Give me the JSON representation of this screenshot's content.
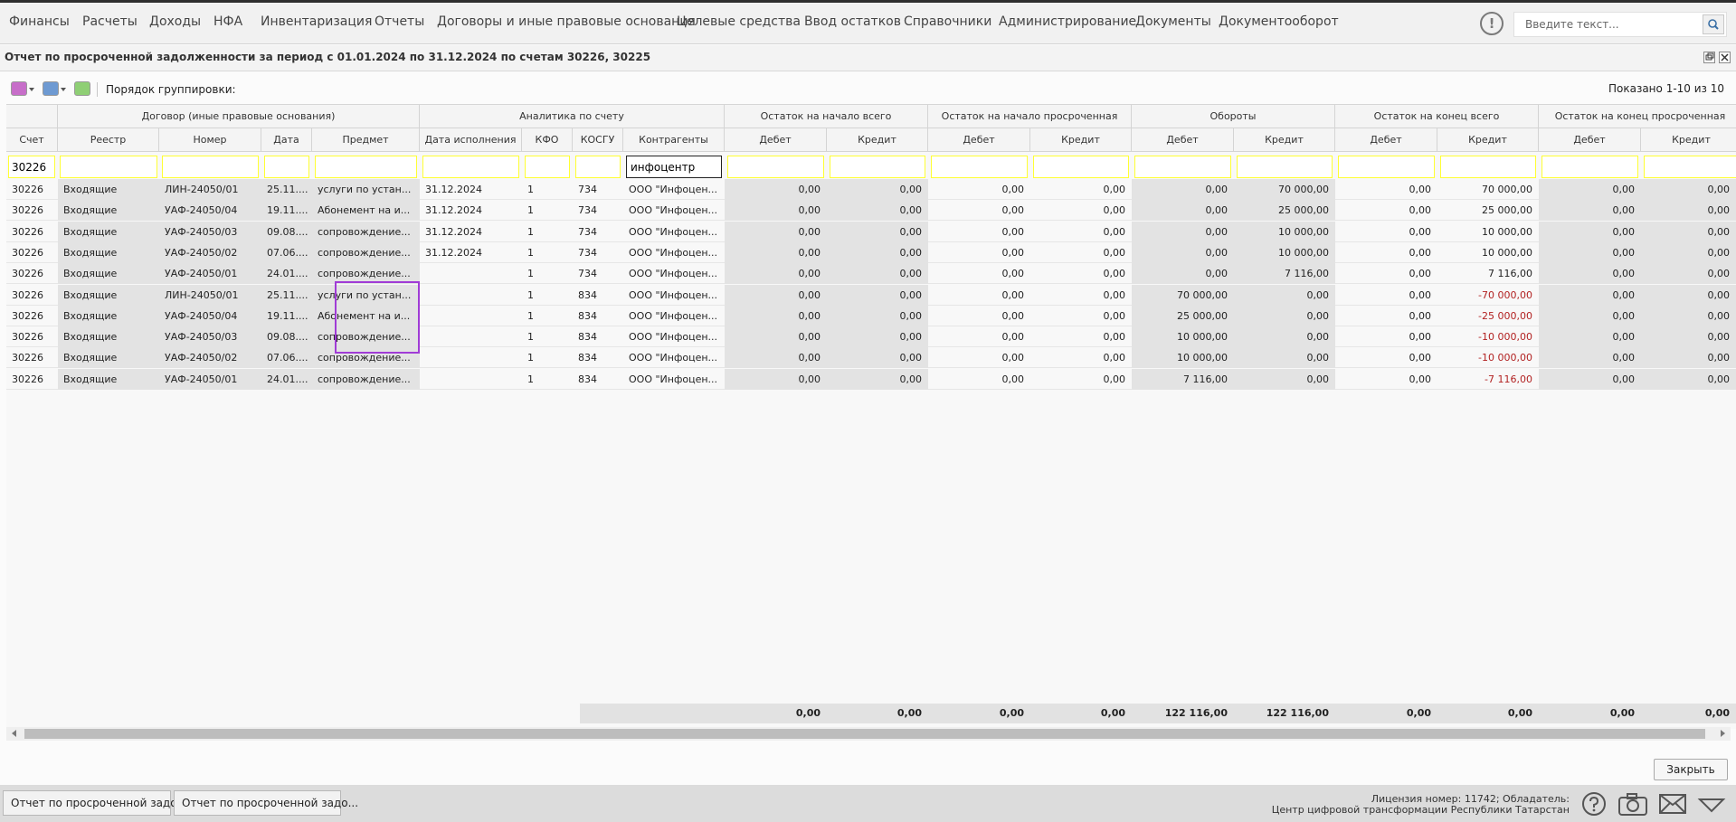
{
  "menu": [
    "Финансы",
    "Расчеты",
    "Доходы",
    "НФА",
    "Инвентаризация",
    "Отчеты",
    "Договоры и иные правовые основания",
    "Целевые средства",
    "Ввод остатков",
    "Справочники",
    "Администрирование",
    "Документы",
    "Документооборот"
  ],
  "alert_icon": "!",
  "search": {
    "placeholder": "Введите текст..."
  },
  "window": {
    "title": "Отчет по просроченной задолженности за период с 01.01.2024 по 31.12.2024 по счетам 30226, 30225"
  },
  "toolbar": {
    "group_label": "Порядок группировки:",
    "shown": "Показано 1-10 из 10"
  },
  "header_groups": [
    "Договор (иные правовые основания)",
    "Аналитика по счету",
    "Остаток на начало всего",
    "Остаток на начало просроченная",
    "Обороты",
    "Остаток на конец всего",
    "Остаток на конец просроченная"
  ],
  "columns": [
    "Счет",
    "Реестр",
    "Номер",
    "Дата",
    "Предмет",
    "Дата исполнения",
    "КФО",
    "КОСГУ",
    "Контрагенты",
    "Дебет",
    "Кредит",
    "Дебет",
    "Кредит",
    "Дебет",
    "Кредит",
    "Дебет",
    "Кредит",
    "Дебет",
    "Кредит"
  ],
  "filters": {
    "schet": "30226",
    "kontragenty": "инфоцентр"
  },
  "rows": [
    [
      "30226",
      "Входящие",
      "ЛИН-24050/01",
      "25.11....",
      "услуги по устан...",
      "31.12.2024",
      "1",
      "734",
      "ООО \"Инфоцен...",
      "0,00",
      "0,00",
      "0,00",
      "0,00",
      "0,00",
      "70 000,00",
      "0,00",
      "70 000,00",
      "0,00",
      "0,00"
    ],
    [
      "30226",
      "Входящие",
      "УАФ-24050/04",
      "19.11....",
      "Абонемент на и...",
      "31.12.2024",
      "1",
      "734",
      "ООО \"Инфоцен...",
      "0,00",
      "0,00",
      "0,00",
      "0,00",
      "0,00",
      "25 000,00",
      "0,00",
      "25 000,00",
      "0,00",
      "0,00"
    ],
    [
      "30226",
      "Входящие",
      "УАФ-24050/03",
      "09.08....",
      "сопровождение...",
      "31.12.2024",
      "1",
      "734",
      "ООО \"Инфоцен...",
      "0,00",
      "0,00",
      "0,00",
      "0,00",
      "0,00",
      "10 000,00",
      "0,00",
      "10 000,00",
      "0,00",
      "0,00"
    ],
    [
      "30226",
      "Входящие",
      "УАФ-24050/02",
      "07.06....",
      "сопровождение...",
      "31.12.2024",
      "1",
      "734",
      "ООО \"Инфоцен...",
      "0,00",
      "0,00",
      "0,00",
      "0,00",
      "0,00",
      "10 000,00",
      "0,00",
      "10 000,00",
      "0,00",
      "0,00"
    ],
    [
      "30226",
      "Входящие",
      "УАФ-24050/01",
      "24.01....",
      "сопровождение...",
      "",
      "1",
      "734",
      "ООО \"Инфоцен...",
      "0,00",
      "0,00",
      "0,00",
      "0,00",
      "0,00",
      "7 116,00",
      "0,00",
      "7 116,00",
      "0,00",
      "0,00"
    ],
    [
      "30226",
      "Входящие",
      "ЛИН-24050/01",
      "25.11....",
      "услуги по устан...",
      "",
      "1",
      "834",
      "ООО \"Инфоцен...",
      "0,00",
      "0,00",
      "0,00",
      "0,00",
      "70 000,00",
      "0,00",
      "0,00",
      "-70 000,00",
      "0,00",
      "0,00"
    ],
    [
      "30226",
      "Входящие",
      "УАФ-24050/04",
      "19.11....",
      "Абонемент на и...",
      "",
      "1",
      "834",
      "ООО \"Инфоцен...",
      "0,00",
      "0,00",
      "0,00",
      "0,00",
      "25 000,00",
      "0,00",
      "0,00",
      "-25 000,00",
      "0,00",
      "0,00"
    ],
    [
      "30226",
      "Входящие",
      "УАФ-24050/03",
      "09.08....",
      "сопровождение...",
      "",
      "1",
      "834",
      "ООО \"Инфоцен...",
      "0,00",
      "0,00",
      "0,00",
      "0,00",
      "10 000,00",
      "0,00",
      "0,00",
      "-10 000,00",
      "0,00",
      "0,00"
    ],
    [
      "30226",
      "Входящие",
      "УАФ-24050/02",
      "07.06....",
      "сопровождение...",
      "",
      "1",
      "834",
      "ООО \"Инфоцен...",
      "0,00",
      "0,00",
      "0,00",
      "0,00",
      "10 000,00",
      "0,00",
      "0,00",
      "-10 000,00",
      "0,00",
      "0,00"
    ],
    [
      "30226",
      "Входящие",
      "УАФ-24050/01",
      "24.01....",
      "сопровождение...",
      "",
      "1",
      "834",
      "ООО \"Инфоцен...",
      "0,00",
      "0,00",
      "0,00",
      "0,00",
      "7 116,00",
      "0,00",
      "0,00",
      "-7 116,00",
      "0,00",
      "0,00"
    ]
  ],
  "totals": [
    "0,00",
    "0,00",
    "0,00",
    "0,00",
    "122 116,00",
    "122 116,00",
    "0,00",
    "0,00",
    "0,00",
    "0,00"
  ],
  "buttons": {
    "close": "Закрыть"
  },
  "taskbar": {
    "tabs": [
      "Отчет по просроченной задо...",
      "Отчет по просроченной задо..."
    ],
    "license_line1": "Лицензия номер: 11742; Обладатель:",
    "license_line2": "Центр цифровой трансформации Республики Татарстан"
  },
  "colors": {
    "filter_border": "#ffff33",
    "negative": "#b22222",
    "highlight_box": "#a03cd6"
  }
}
